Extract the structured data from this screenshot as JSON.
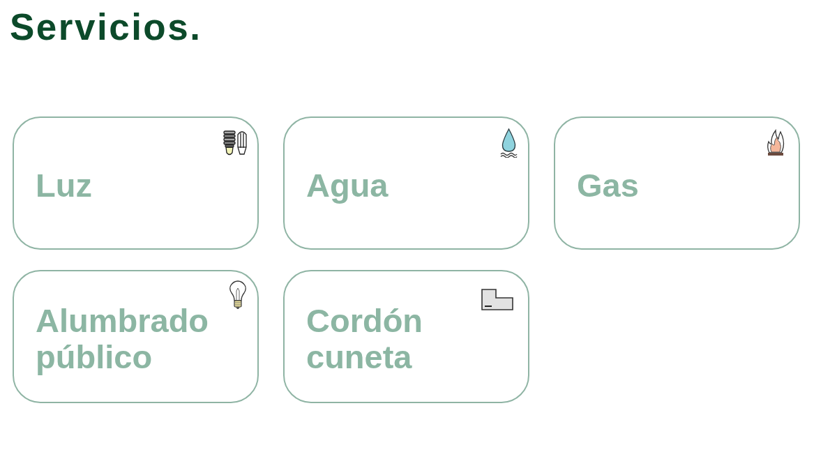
{
  "title": "Servicios.",
  "services": [
    {
      "label": "Luz",
      "kind": "bulbs"
    },
    {
      "label": "Agua",
      "kind": "drop"
    },
    {
      "label": "Gas",
      "kind": "flame"
    },
    {
      "label": "Alumbrado público",
      "kind": "lightbulb"
    },
    {
      "label": "Cordón cuneta",
      "kind": "curb"
    }
  ]
}
